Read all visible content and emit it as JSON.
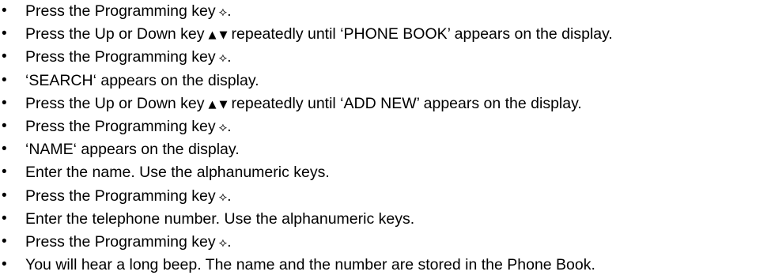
{
  "steps": [
    {
      "type": "prog",
      "text": "Press the Programming key",
      "after": "."
    },
    {
      "type": "arrows",
      "before": "Press the Up or Down key",
      "after": "repeatedly until ‘PHONE BOOK’ appears on the display."
    },
    {
      "type": "prog",
      "text": "Press the Programming key",
      "after": "."
    },
    {
      "type": "plain",
      "text": "‘SEARCH‘ appears on the display."
    },
    {
      "type": "arrows",
      "before": "Press the Up or Down key",
      "after": "repeatedly until ‘ADD NEW’ appears on the display."
    },
    {
      "type": "prog",
      "text": "Press the Programming key",
      "after": "."
    },
    {
      "type": "plain",
      "text": "‘NAME‘ appears on the display."
    },
    {
      "type": "plain",
      "text": "Enter the name. Use the alphanumeric keys."
    },
    {
      "type": "prog",
      "text": "Press the Programming key",
      "after": "."
    },
    {
      "type": "plain",
      "text": "Enter the telephone number. Use the alphanumeric keys."
    },
    {
      "type": "prog",
      "text": "Press the Programming key",
      "after": "."
    },
    {
      "type": "plain",
      "text": "You will hear a long beep. The name and the number are stored in the Phone Book."
    }
  ],
  "icons": {
    "programming_key": "programming-key-icon",
    "up_key": "up-arrow-icon",
    "down_key": "down-arrow-icon"
  },
  "bullet": "•"
}
